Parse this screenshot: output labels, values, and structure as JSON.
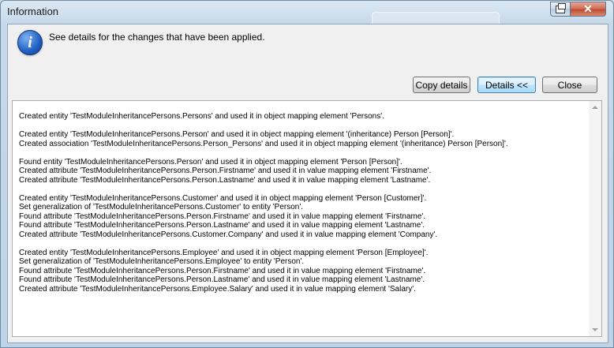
{
  "window": {
    "title": "Information"
  },
  "message": "See details for the changes that have been applied.",
  "buttons": {
    "copy_details": "Copy details",
    "details": "Details <<",
    "close": "Close",
    "titlebar_close": "✕"
  },
  "details": [
    [
      "Created entity 'TestModuleInheritancePersons.Persons' and used it in object mapping element 'Persons'."
    ],
    [
      "Created entity 'TestModuleInheritancePersons.Person' and used it in object mapping element '(inheritance) Person [Person]'.",
      "Created association 'TestModuleInheritancePersons.Person_Persons' and used it in object mapping element '(inheritance) Person [Person]'."
    ],
    [
      "Found entity 'TestModuleInheritancePersons.Person' and used it in object mapping element 'Person [Person]'.",
      "Created attribute 'TestModuleInheritancePersons.Person.Firstname' and used it in value mapping element 'Firstname'.",
      "Created attribute 'TestModuleInheritancePersons.Person.Lastname' and used it in value mapping element 'Lastname'."
    ],
    [
      "Created entity 'TestModuleInheritancePersons.Customer' and used it in object mapping element 'Person [Customer]'.",
      "Set generalization of 'TestModuleInheritancePersons.Customer' to entity 'Person'.",
      "Found attribute 'TestModuleInheritancePersons.Person.Firstname' and used it in value mapping element 'Firstname'.",
      "Found attribute 'TestModuleInheritancePersons.Person.Lastname' and used it in value mapping element 'Lastname'.",
      "Created attribute 'TestModuleInheritancePersons.Customer.Company' and used it in value mapping element 'Company'."
    ],
    [
      "Created entity 'TestModuleInheritancePersons.Employee' and used it in object mapping element 'Person [Employee]'.",
      "Set generalization of 'TestModuleInheritancePersons.Employee' to entity 'Person'.",
      "Found attribute 'TestModuleInheritancePersons.Person.Firstname' and used it in value mapping element 'Firstname'.",
      "Found attribute 'TestModuleInheritancePersons.Person.Lastname' and used it in value mapping element 'Lastname'.",
      "Created attribute 'TestModuleInheritancePersons.Employee.Salary' and used it in value mapping element 'Salary'."
    ]
  ]
}
